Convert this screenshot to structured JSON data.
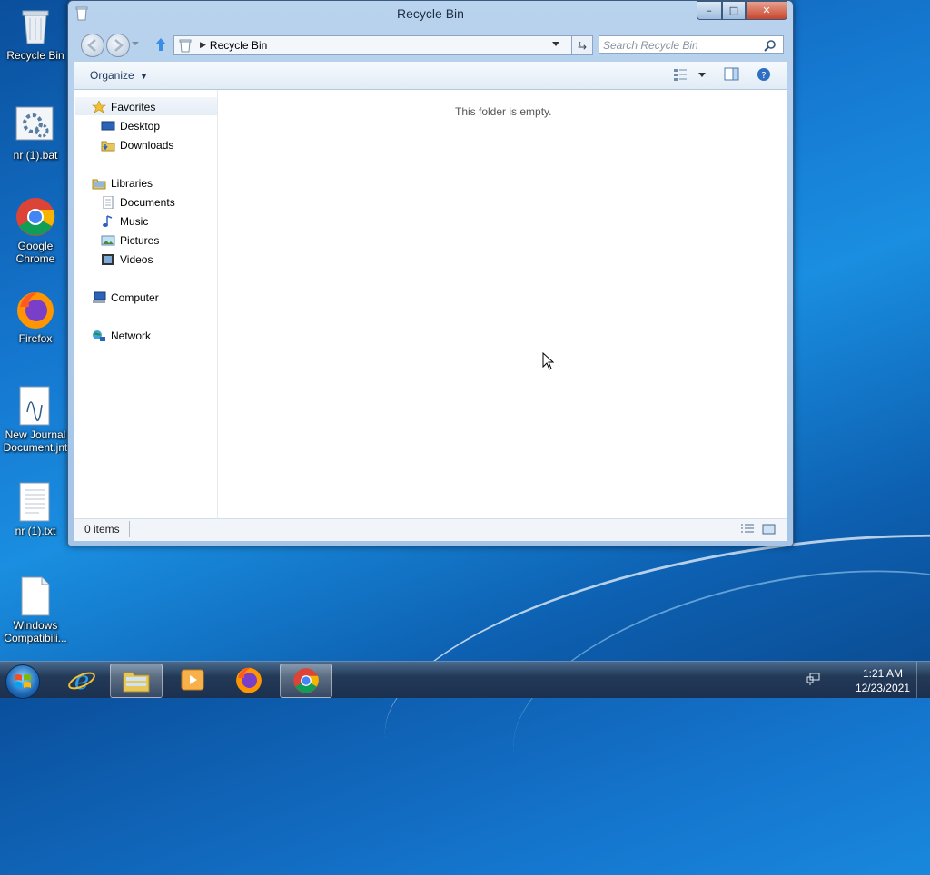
{
  "desktop": {
    "icons": [
      {
        "label": "Recycle Bin",
        "icon": "recycle-bin-icon"
      },
      {
        "label": "nr (1).bat",
        "icon": "batch-file-icon"
      },
      {
        "label": "Google Chrome",
        "icon": "chrome-icon"
      },
      {
        "label": "Firefox",
        "icon": "firefox-icon"
      },
      {
        "label": "New Journal Document.jnt",
        "icon": "journal-icon"
      },
      {
        "label": "nr (1).txt",
        "icon": "text-file-icon"
      },
      {
        "label": "Windows Compatibili...",
        "icon": "file-icon"
      }
    ]
  },
  "window": {
    "title": "Recycle Bin",
    "controls": {
      "minimize": "–",
      "maximize": "□",
      "close": "✕"
    },
    "address": {
      "path": "Recycle Bin"
    },
    "search": {
      "placeholder": "Search Recycle Bin"
    },
    "toolbar": {
      "organize": "Organize"
    },
    "nav": {
      "favorites": "Favorites",
      "favorites_items": [
        "Desktop",
        "Downloads"
      ],
      "libraries": "Libraries",
      "libraries_items": [
        "Documents",
        "Music",
        "Pictures",
        "Videos"
      ],
      "computer": "Computer",
      "network": "Network"
    },
    "content": {
      "empty_message": "This folder is empty."
    },
    "status": {
      "items": "0 items"
    }
  },
  "taskbar": {
    "clock_time": "1:21 AM",
    "clock_date": "12/23/2021",
    "apps": [
      "internet-explorer-icon",
      "windows-explorer-icon",
      "media-player-icon",
      "firefox-icon",
      "chrome-icon"
    ]
  },
  "colors": {
    "desktop_blue": "#1577cf",
    "window_frame": "#b9d3ee",
    "close_red": "#c8452c"
  }
}
